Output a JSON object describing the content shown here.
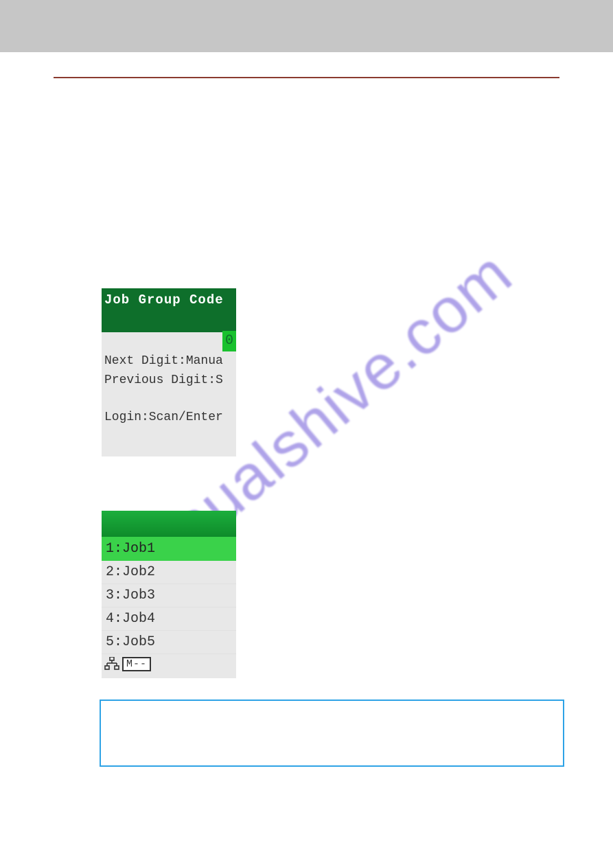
{
  "screen1": {
    "title": "Job Group Code",
    "value": "0",
    "line_next": "Next Digit:Manua",
    "line_prev": "Previous Digit:S",
    "line_login": "Login:Scan/Enter"
  },
  "screen2": {
    "items": [
      {
        "label": "1:Job1",
        "selected": true
      },
      {
        "label": "2:Job2",
        "selected": false
      },
      {
        "label": "3:Job3",
        "selected": false
      },
      {
        "label": "4:Job4",
        "selected": false
      },
      {
        "label": "5:Job5",
        "selected": false
      }
    ],
    "status_box": "M--"
  },
  "watermark": "manualshive.com",
  "page_number": ""
}
